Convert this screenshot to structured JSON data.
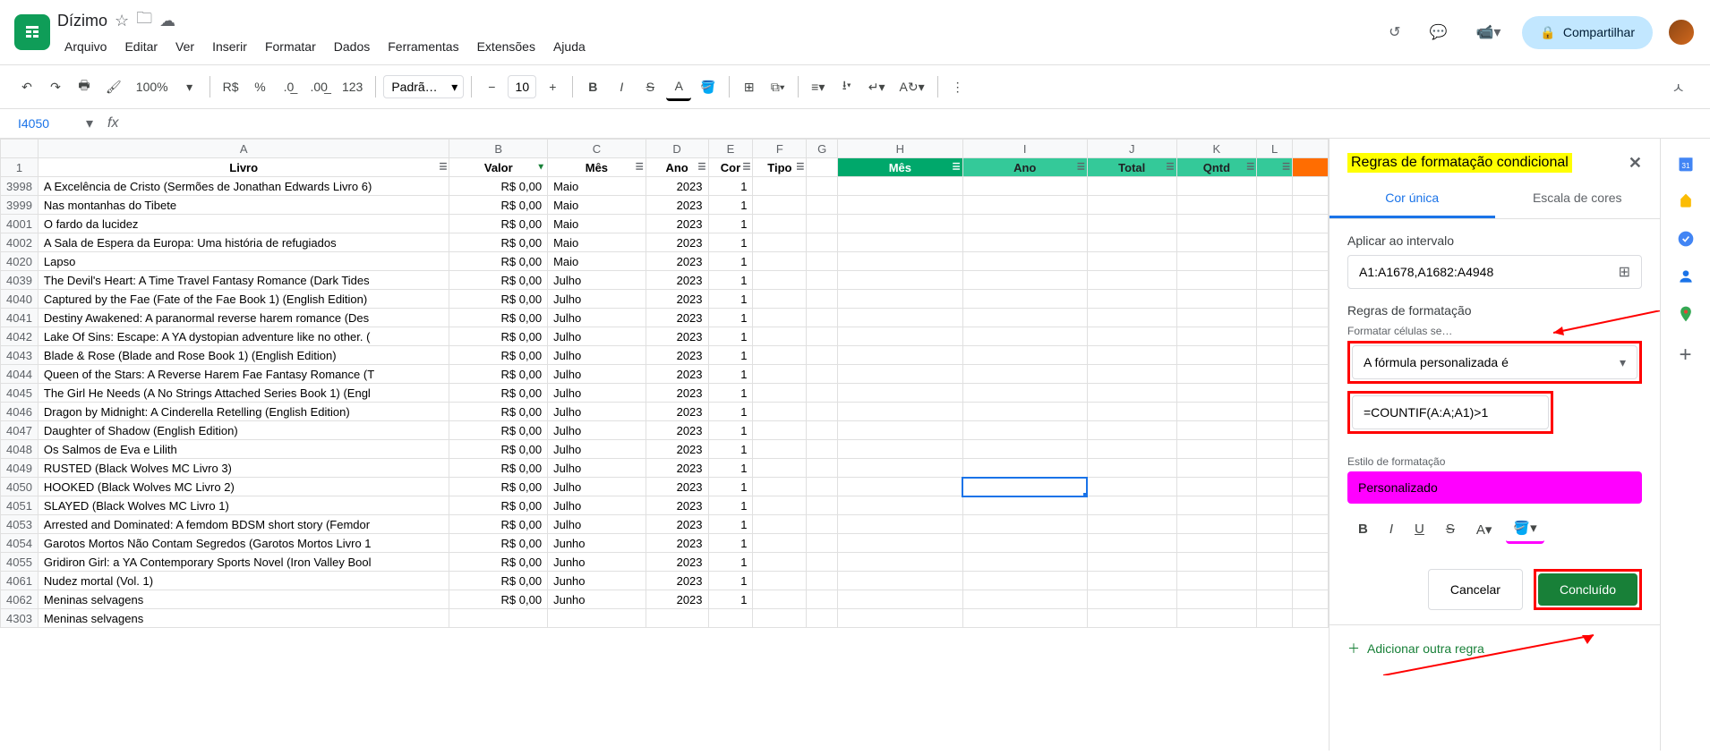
{
  "doc_title": "Dízimo",
  "menu": [
    "Arquivo",
    "Editar",
    "Ver",
    "Inserir",
    "Formatar",
    "Dados",
    "Ferramentas",
    "Extensões",
    "Ajuda"
  ],
  "share_label": "Compartilhar",
  "toolbar": {
    "zoom": "100%",
    "currency": "R$",
    "percent": "%",
    "decrease_dec": ".0_",
    "increase_dec": ".00",
    "numfmt": "123",
    "font": "Padrã…",
    "font_size": "10"
  },
  "name_box": "I4050",
  "columns": [
    "",
    "A",
    "B",
    "C",
    "D",
    "E",
    "F",
    "G",
    "H",
    "I",
    "J",
    "K",
    "L",
    ""
  ],
  "header_row": {
    "livro": "Livro",
    "valor": "Valor",
    "mes": "Mês",
    "ano": "Ano",
    "cor": "Cor",
    "tipo": "Tipo",
    "mes2": "Mês",
    "ano2": "Ano",
    "total": "Total",
    "qntd": "Qntd"
  },
  "rows": [
    {
      "n": "3998",
      "a": "A Excelência de Cristo (Sermões de Jonathan Edwards Livro 6)",
      "b": "R$ 0,00",
      "c": "Maio",
      "d": "2023",
      "e": "1"
    },
    {
      "n": "3999",
      "a": "Nas montanhas do Tibete",
      "b": "R$ 0,00",
      "c": "Maio",
      "d": "2023",
      "e": "1"
    },
    {
      "n": "4001",
      "a": "O fardo da lucidez",
      "b": "R$ 0,00",
      "c": "Maio",
      "d": "2023",
      "e": "1"
    },
    {
      "n": "4002",
      "a": "A Sala de Espera da Europa: Uma história de refugiados",
      "b": "R$ 0,00",
      "c": "Maio",
      "d": "2023",
      "e": "1"
    },
    {
      "n": "4020",
      "a": "Lapso",
      "b": "R$ 0,00",
      "c": "Maio",
      "d": "2023",
      "e": "1"
    },
    {
      "n": "4039",
      "a": "The Devil's Heart: A Time Travel Fantasy Romance (Dark Tides",
      "b": "R$ 0,00",
      "c": "Julho",
      "d": "2023",
      "e": "1"
    },
    {
      "n": "4040",
      "a": "Captured by the Fae (Fate of the Fae Book 1) (English Edition)",
      "b": "R$ 0,00",
      "c": "Julho",
      "d": "2023",
      "e": "1"
    },
    {
      "n": "4041",
      "a": "Destiny Awakened: A paranormal reverse harem romance (Des",
      "b": "R$ 0,00",
      "c": "Julho",
      "d": "2023",
      "e": "1"
    },
    {
      "n": "4042",
      "a": "Lake Of Sins: Escape: A YA dystopian adventure like no other. (",
      "b": "R$ 0,00",
      "c": "Julho",
      "d": "2023",
      "e": "1"
    },
    {
      "n": "4043",
      "a": "Blade & Rose (Blade and Rose Book 1) (English Edition)",
      "b": "R$ 0,00",
      "c": "Julho",
      "d": "2023",
      "e": "1"
    },
    {
      "n": "4044",
      "a": "Queen of the Stars: A Reverse Harem Fae Fantasy Romance (T",
      "b": "R$ 0,00",
      "c": "Julho",
      "d": "2023",
      "e": "1"
    },
    {
      "n": "4045",
      "a": "The Girl He Needs (A No Strings Attached Series Book 1) (Engl",
      "b": "R$ 0,00",
      "c": "Julho",
      "d": "2023",
      "e": "1"
    },
    {
      "n": "4046",
      "a": "Dragon by Midnight: A Cinderella Retelling (English Edition)",
      "b": "R$ 0,00",
      "c": "Julho",
      "d": "2023",
      "e": "1"
    },
    {
      "n": "4047",
      "a": "Daughter of Shadow (English Edition)",
      "b": "R$ 0,00",
      "c": "Julho",
      "d": "2023",
      "e": "1"
    },
    {
      "n": "4048",
      "a": "Os Salmos de Eva e Lilith",
      "b": "R$ 0,00",
      "c": "Julho",
      "d": "2023",
      "e": "1"
    },
    {
      "n": "4049",
      "a": "RUSTED (Black Wolves MC Livro 3)",
      "b": "R$ 0,00",
      "c": "Julho",
      "d": "2023",
      "e": "1"
    },
    {
      "n": "4050",
      "a": "HOOKED (Black Wolves MC Livro 2)",
      "b": "R$ 0,00",
      "c": "Julho",
      "d": "2023",
      "e": "1"
    },
    {
      "n": "4051",
      "a": "SLAYED (Black Wolves MC Livro 1)",
      "b": "R$ 0,00",
      "c": "Julho",
      "d": "2023",
      "e": "1"
    },
    {
      "n": "4053",
      "a": "Arrested and Dominated: A femdom BDSM short story (Femdor",
      "b": "R$ 0,00",
      "c": "Julho",
      "d": "2023",
      "e": "1"
    },
    {
      "n": "4054",
      "a": "Garotos Mortos Não Contam Segredos (Garotos Mortos Livro 1",
      "b": "R$ 0,00",
      "c": "Junho",
      "d": "2023",
      "e": "1"
    },
    {
      "n": "4055",
      "a": "Gridiron Girl: a YA Contemporary Sports Novel (Iron Valley Bool",
      "b": "R$ 0,00",
      "c": "Junho",
      "d": "2023",
      "e": "1"
    },
    {
      "n": "4061",
      "a": "Nudez mortal (Vol. 1)",
      "b": "R$ 0,00",
      "c": "Junho",
      "d": "2023",
      "e": "1"
    },
    {
      "n": "4062",
      "a": "Meninas selvagens",
      "b": "R$ 0,00",
      "c": "Junho",
      "d": "2023",
      "e": "1",
      "hl": true
    },
    {
      "n": "4303",
      "a": "Meninas selvagens",
      "b": "",
      "c": "",
      "d": "",
      "e": "",
      "hl": true
    }
  ],
  "panel": {
    "title": "Regras de formatação condicional",
    "tab_single": "Cor única",
    "tab_scale": "Escala de cores",
    "apply_label": "Aplicar ao intervalo",
    "range": "A1:A1678,A1682:A4948",
    "rules_label": "Regras de formatação",
    "format_if": "Formatar células se…",
    "rule_type": "A fórmula personalizada é",
    "formula": "=COUNTIF(A:A;A1)>1",
    "style_label": "Estilo de formatação",
    "style_name": "Personalizado",
    "cancel": "Cancelar",
    "done": "Concluído",
    "add_rule": "Adicionar outra regra"
  }
}
